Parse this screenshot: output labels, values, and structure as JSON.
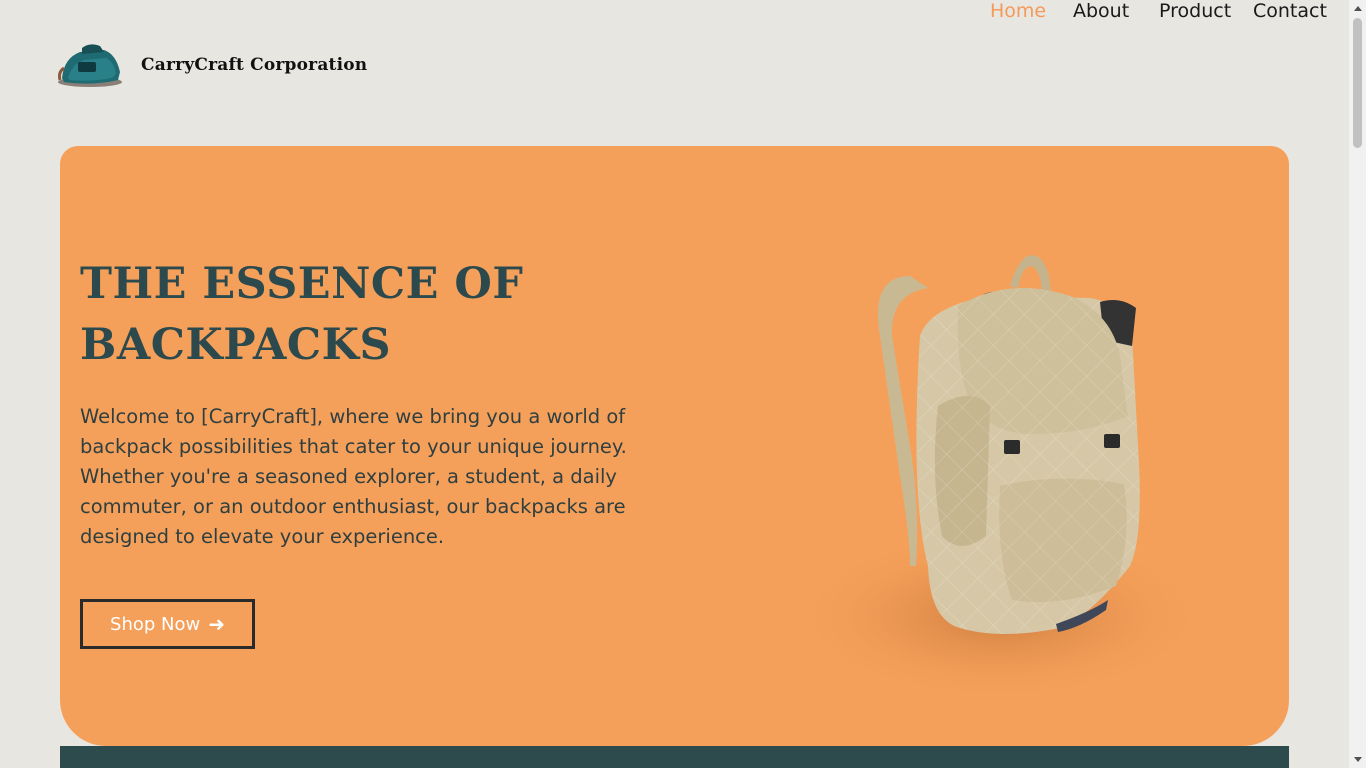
{
  "header": {
    "brand": "CarryCraft Corporation",
    "logo_icon": "backpack-logo-icon"
  },
  "nav": {
    "items": [
      {
        "label": "Home",
        "active": true
      },
      {
        "label": "About",
        "active": false
      },
      {
        "label": "Product",
        "active": false
      },
      {
        "label": "Contact",
        "active": false
      }
    ]
  },
  "hero": {
    "title": "THE ESSENCE OF BACKPACKS",
    "text": "Welcome to [CarryCraft], where we bring you a world of backpack possibilities that cater to your unique journey. Whether you're a seasoned explorer, a student, a daily commuter, or an outdoor enthusiast, our backpacks are designed to elevate your experience.",
    "button_label": "Shop Now",
    "button_icon": "arrow-right-icon",
    "image": "beige-backpack-image"
  },
  "colors": {
    "accent": "#f59a5b",
    "hero_bg": "#f5a05a",
    "dark": "#2d4a4d",
    "page_bg": "#e8e6e1"
  }
}
